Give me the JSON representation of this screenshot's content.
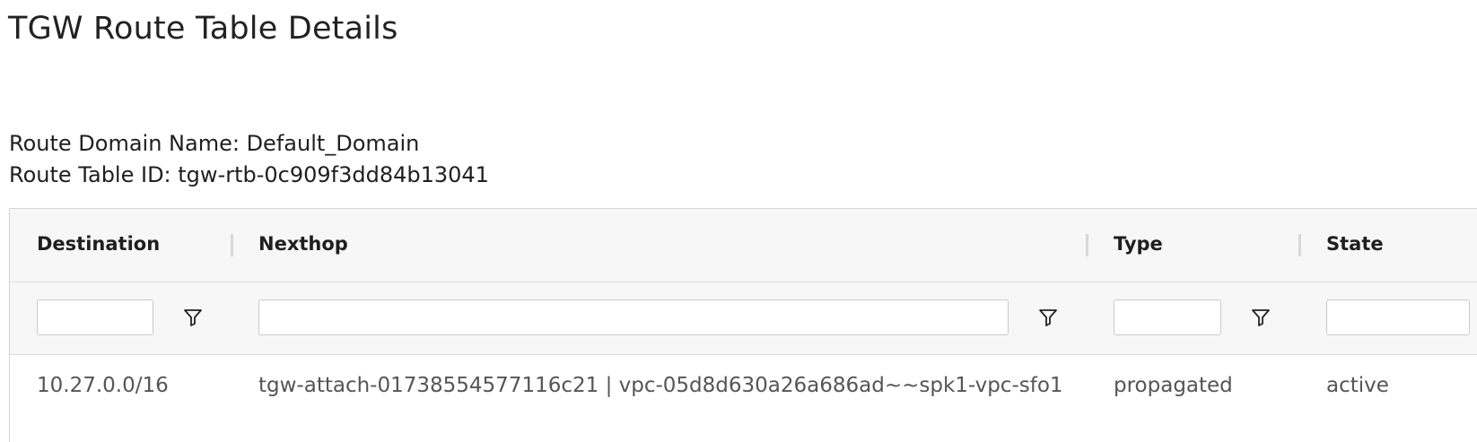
{
  "page": {
    "title": "TGW Route Table Details"
  },
  "info": {
    "route_domain": "Route Domain Name: Default_Domain",
    "route_table_id": "Route Table ID: tgw-rtb-0c909f3dd84b13041"
  },
  "table": {
    "columns": [
      {
        "label": "Destination"
      },
      {
        "label": "Nexthop"
      },
      {
        "label": "Type"
      },
      {
        "label": "State"
      }
    ],
    "filters": {
      "destination": "",
      "nexthop": "",
      "type": "",
      "state": ""
    },
    "rows": [
      {
        "destination": "10.27.0.0/16",
        "nexthop": "tgw-attach-01738554577116c21 | vpc-05d8d630a26a686ad~~spk1-vpc-sfo1",
        "type": "propagated",
        "state": "active"
      }
    ],
    "filter_icon": "funnel-icon"
  },
  "colors": {
    "header_bg": "#f7f7f7",
    "border": "#d4d4d4",
    "cell_text": "#555555"
  }
}
